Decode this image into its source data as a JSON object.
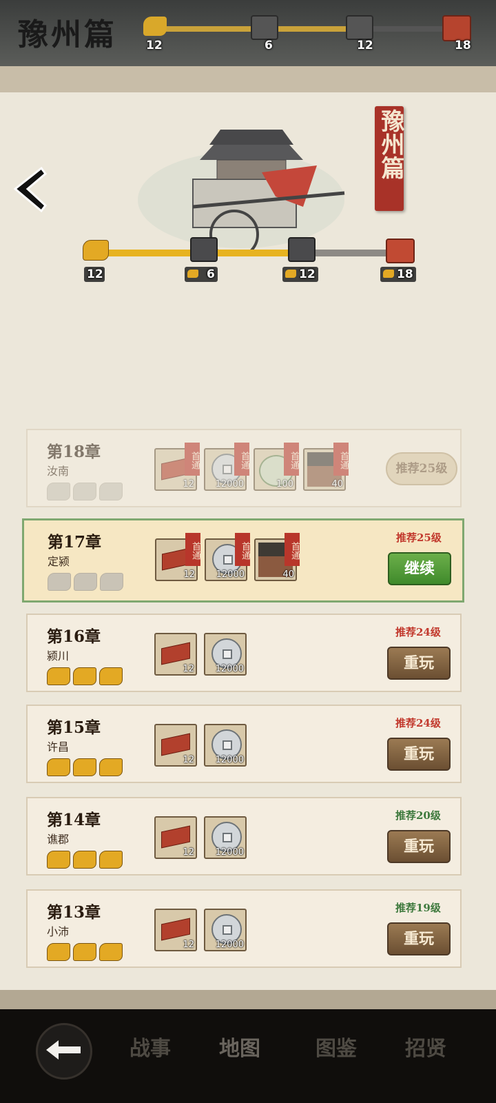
{
  "header": {
    "title": "豫州篇",
    "progress_labels": [
      "12",
      "6",
      "12",
      "18"
    ]
  },
  "hero": {
    "ribbon_text": "豫州篇",
    "progress_labels": [
      "12",
      "6",
      "12",
      "18"
    ],
    "progress_fraction": 0.74
  },
  "chapters": [
    {
      "title": "第18章",
      "place": "汝南",
      "rec": "推荐25级",
      "action": "推荐25级",
      "state": "locked",
      "rewards": [
        {
          "type": "brick",
          "qty": "12",
          "tag": "首通"
        },
        {
          "type": "coin",
          "qty": "12000",
          "tag": "首通"
        },
        {
          "type": "jade",
          "qty": "100",
          "tag": "首通"
        },
        {
          "type": "hero",
          "qty": "40",
          "tag": "首通"
        }
      ],
      "stars": 0
    },
    {
      "title": "第17章",
      "place": "定颍",
      "rec": "推荐25级",
      "action": "继续",
      "state": "active",
      "rewards": [
        {
          "type": "brick",
          "qty": "12",
          "tag": "首通"
        },
        {
          "type": "coin",
          "qty": "12000",
          "tag": "首通"
        },
        {
          "type": "hero",
          "qty": "40",
          "tag": "首通"
        }
      ],
      "stars": 0
    },
    {
      "title": "第16章",
      "place": "颍川",
      "rec": "推荐24级",
      "action": "重玩",
      "state": "done",
      "rewards": [
        {
          "type": "brick",
          "qty": "12"
        },
        {
          "type": "coin",
          "qty": "12000"
        }
      ],
      "stars": 3
    },
    {
      "title": "第15章",
      "place": "许昌",
      "rec": "推荐24级",
      "action": "重玩",
      "state": "done",
      "rewards": [
        {
          "type": "brick",
          "qty": "12"
        },
        {
          "type": "coin",
          "qty": "12000"
        }
      ],
      "stars": 3
    },
    {
      "title": "第14章",
      "place": "谯郡",
      "rec": "推荐20级",
      "action": "重玩",
      "state": "done",
      "rewards": [
        {
          "type": "brick",
          "qty": "12"
        },
        {
          "type": "coin",
          "qty": "12000"
        }
      ],
      "stars": 3
    },
    {
      "title": "第13章",
      "place": "小沛",
      "rec": "推荐19级",
      "action": "重玩",
      "state": "done",
      "rewards": [
        {
          "type": "brick",
          "qty": "12"
        },
        {
          "type": "coin",
          "qty": "12000"
        }
      ],
      "stars": 3
    }
  ],
  "rec_colors": {
    "red": "#c23a2e",
    "green": "#3f7a3e"
  },
  "nav": {
    "items": [
      "战事",
      "地图",
      "图鉴",
      "招贤"
    ],
    "active": "地图"
  },
  "icons": [
    "back-arrow-icon",
    "tiger-icon",
    "chest-icon",
    "coin-icon",
    "brick-icon"
  ]
}
